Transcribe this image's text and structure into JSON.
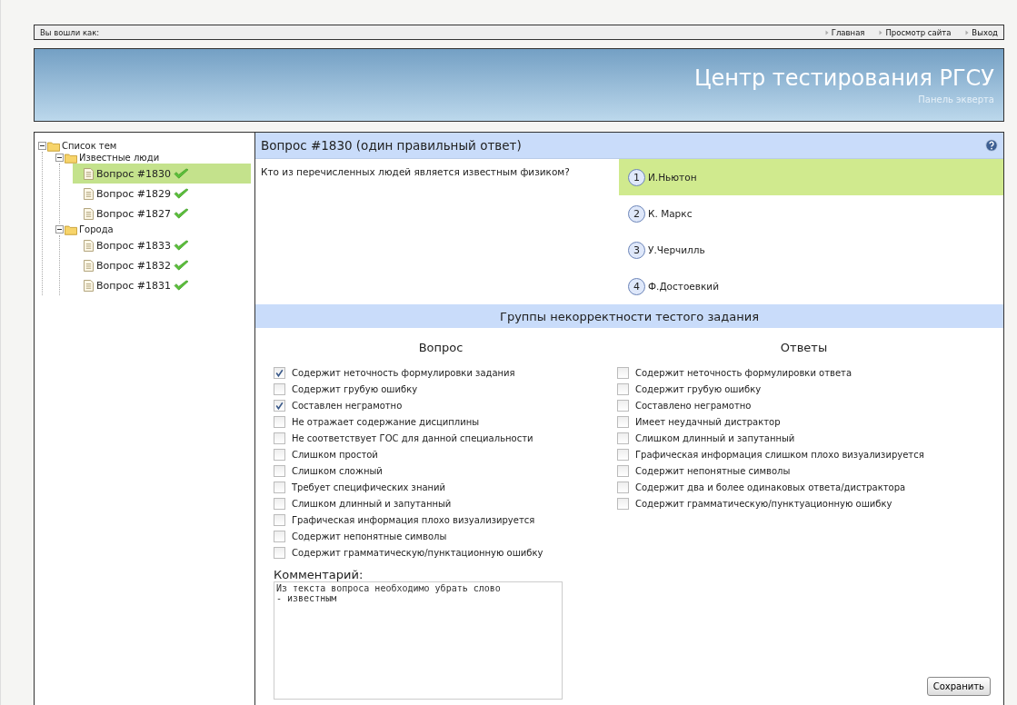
{
  "top_bar": {
    "login_label": "Вы вошли как:",
    "links": [
      {
        "label": "Главная"
      },
      {
        "label": "Просмотр сайта"
      },
      {
        "label": "Выход"
      }
    ]
  },
  "header": {
    "title": "Центр тестирования РГСУ",
    "subtitle": "Панель экверта"
  },
  "tree": {
    "label": "Список тем",
    "kind": "folder",
    "expanded": true,
    "children": [
      {
        "label": "Известные люди",
        "kind": "folder",
        "expanded": true,
        "children": [
          {
            "label": "Вопрос #1830",
            "kind": "question",
            "selected": true
          },
          {
            "label": "Вопрос #1829",
            "kind": "question",
            "selected": false
          },
          {
            "label": "Вопрос #1827",
            "kind": "question",
            "selected": false
          }
        ]
      },
      {
        "label": "Города",
        "kind": "folder",
        "expanded": true,
        "children": [
          {
            "label": "Вопрос #1833",
            "kind": "question",
            "selected": false
          },
          {
            "label": "Вопрос #1832",
            "kind": "question",
            "selected": false
          },
          {
            "label": "Вопрос #1831",
            "kind": "question",
            "selected": false
          }
        ]
      }
    ]
  },
  "question": {
    "title": "Вопрос #1830 (один правильный ответ)",
    "text": "Кто из перечисленных людей является известным физиком?",
    "answers": [
      {
        "number": "1",
        "label": "И.Ньютон",
        "selected": true
      },
      {
        "number": "2",
        "label": "К. Маркс",
        "selected": false
      },
      {
        "number": "3",
        "label": "У.Черчилль",
        "selected": false
      },
      {
        "number": "4",
        "label": "Ф.Достоевкий",
        "selected": false
      }
    ]
  },
  "groups": {
    "title": "Группы некорректности тестого задания",
    "question_column": {
      "heading": "Вопрос",
      "items": [
        {
          "label": "Содержит неточность формулировки задания",
          "checked": true
        },
        {
          "label": "Содержит грубую ошибку",
          "checked": false
        },
        {
          "label": "Составлен неграмотно",
          "checked": true
        },
        {
          "label": "Не отражает содержание дисциплины",
          "checked": false
        },
        {
          "label": "Не соответствует ГОС для данной специальности",
          "checked": false
        },
        {
          "label": "Слишком простой",
          "checked": false
        },
        {
          "label": "Слишком сложный",
          "checked": false
        },
        {
          "label": "Требует специфических знаний",
          "checked": false
        },
        {
          "label": "Слишком длинный и запутанный",
          "checked": false
        },
        {
          "label": "Графическая информация плохо визуализируется",
          "checked": false
        },
        {
          "label": "Содержит непонятные символы",
          "checked": false
        },
        {
          "label": "Содержит грамматическую/пунктационную ошибку",
          "checked": false
        }
      ]
    },
    "answers_column": {
      "heading": "Ответы",
      "items": [
        {
          "label": "Содержит неточность формулировки ответа",
          "checked": false
        },
        {
          "label": "Содержит грубую ошибку",
          "checked": false
        },
        {
          "label": "Составлено неграмотно",
          "checked": false
        },
        {
          "label": "Имеет неудачный дистрактор",
          "checked": false
        },
        {
          "label": "Слишком длинный и запутанный",
          "checked": false
        },
        {
          "label": "Графическая информация слишком плохо визуализируется",
          "checked": false
        },
        {
          "label": "Содержит непонятные символы",
          "checked": false
        },
        {
          "label": "Содержит два и более одинаковых ответа/дистрактора",
          "checked": false
        },
        {
          "label": "Содержит грамматическую/пунктуационную ошибку",
          "checked": false
        }
      ]
    }
  },
  "comment": {
    "label": "Комментарий:",
    "value": "Из текста вопроса необходимо убрать слово\n- известным"
  },
  "save_button": "Сохранить"
}
